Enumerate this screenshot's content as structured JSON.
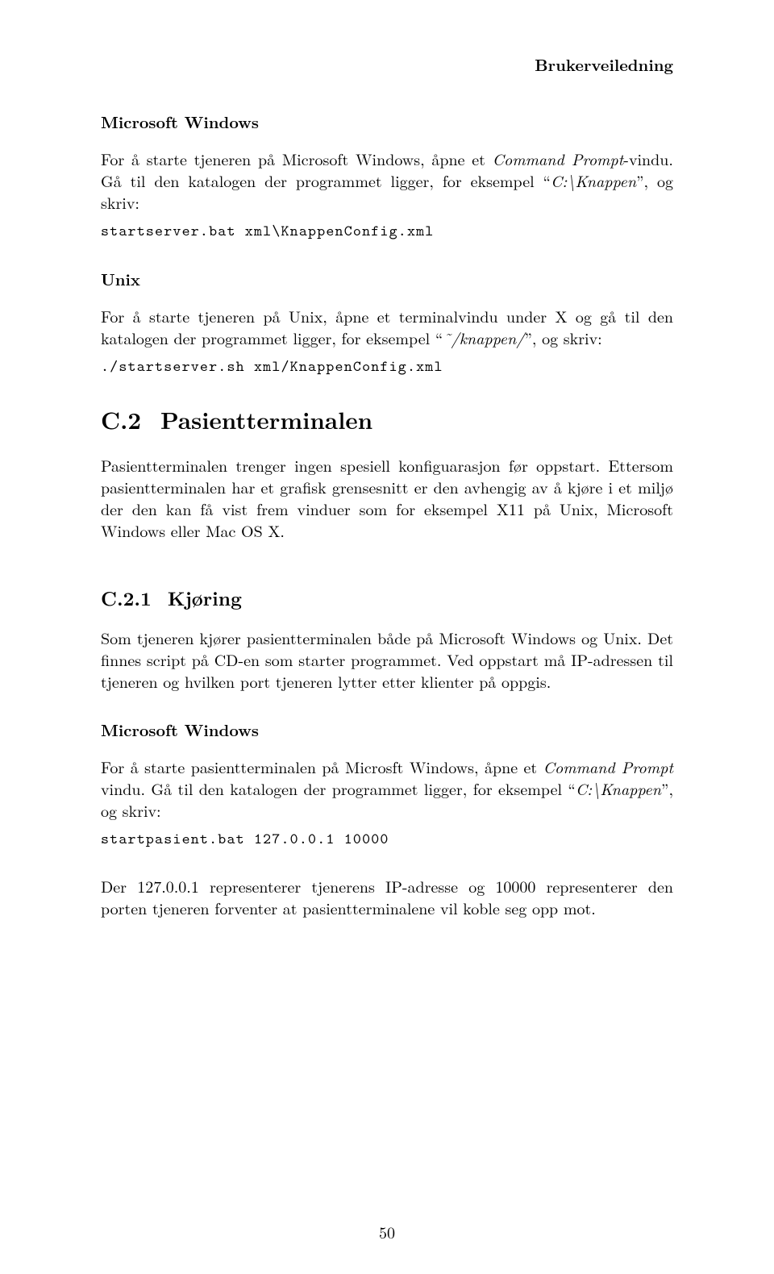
{
  "header": "Brukerveiledning",
  "s1": {
    "title": "Microsoft Windows",
    "p1a": "For å starte tjeneren på Microsoft Windows, åpne et ",
    "p1b": "Command Prompt",
    "p1c": "-vindu. Gå til den katalogen der programmet ligger, for eksempel “",
    "p1d": "C:\\Knappen",
    "p1e": "”, og skriv:",
    "code": "startserver.bat xml\\KnappenConfig.xml"
  },
  "s2": {
    "title": "Unix",
    "p1a": "For å starte tjeneren på Unix, åpne et terminalvindu under X og gå til den katalogen der programmet ligger, for eksempel “",
    "p1b": "˜/knappen/",
    "p1c": "”, og skriv:",
    "code": "./startserver.sh xml/KnappenConfig.xml"
  },
  "s3": {
    "num": "C.2",
    "title": "Pasientterminalen",
    "p1": "Pasientterminalen trenger ingen spesiell konfiguarasjon før oppstart. Ettersom pasientterminalen har et grafisk grensesnitt er den avhengig av å kjøre i et miljø der den kan få vist frem vinduer som for eksempel X11 på Unix, Microsoft Windows eller Mac OS X."
  },
  "s4": {
    "num": "C.2.1",
    "title": "Kjøring",
    "p1": "Som tjeneren kjører pasientterminalen både på Microsoft Windows og Unix. Det finnes script på CD-en som starter programmet. Ved oppstart må IP-adressen til tjeneren og hvilken port tjeneren lytter etter klienter på oppgis."
  },
  "s5": {
    "title": "Microsoft Windows",
    "p1a": "For å starte pasientterminalen på Microsft Windows, åpne et ",
    "p1b": "Command Prompt",
    "p1c": " vindu. Gå til den katalogen der programmet ligger, for eksempel “",
    "p1d": "C:\\Knappen",
    "p1e": "”, og skriv:",
    "code": "startpasient.bat 127.0.0.1 10000",
    "p2": "Der 127.0.0.1 representerer tjenerens IP-adresse og 10000 representerer den porten tjeneren forventer at pasientterminalene vil koble seg opp mot."
  },
  "pagenum": "50"
}
